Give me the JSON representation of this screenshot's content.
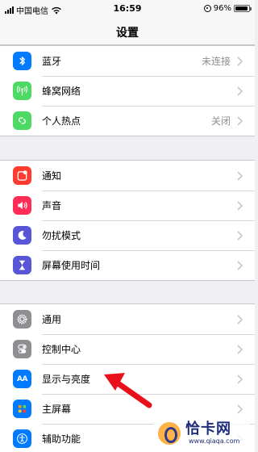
{
  "status_bar": {
    "carrier": "中国电信",
    "time": "16:59",
    "battery_text": "96%",
    "battery_level": 0.96
  },
  "nav": {
    "title": "设置"
  },
  "groups": [
    [
      {
        "label": "蓝牙",
        "value": "未连接",
        "icon": "bluetooth-icon",
        "color": "#007aff"
      },
      {
        "label": "蜂窝网络",
        "value": "",
        "icon": "cellular-icon",
        "color": "#4cd964"
      },
      {
        "label": "个人热点",
        "value": "关闭",
        "icon": "hotspot-icon",
        "color": "#4cd964"
      }
    ],
    [
      {
        "label": "通知",
        "value": "",
        "icon": "notifications-icon",
        "color": "#ff3b30"
      },
      {
        "label": "声音",
        "value": "",
        "icon": "sound-icon",
        "color": "#ff2d55"
      },
      {
        "label": "勿扰模式",
        "value": "",
        "icon": "moon-icon",
        "color": "#5856d6"
      },
      {
        "label": "屏幕使用时间",
        "value": "",
        "icon": "hourglass-icon",
        "color": "#5856d6"
      }
    ],
    [
      {
        "label": "通用",
        "value": "",
        "icon": "gear-icon",
        "color": "#8e8e93"
      },
      {
        "label": "控制中心",
        "value": "",
        "icon": "toggles-icon",
        "color": "#8e8e93"
      },
      {
        "label": "显示与亮度",
        "value": "",
        "icon": "text-size-icon",
        "color": "#007aff"
      },
      {
        "label": "主屏幕",
        "value": "",
        "icon": "home-screen-icon",
        "color": "#007aff"
      },
      {
        "label": "辅助功能",
        "value": "",
        "icon": "accessibility-icon",
        "color": "#007aff"
      }
    ]
  ],
  "icon_text": {
    "text_size": "AA"
  },
  "watermark": {
    "title": "恰卡网",
    "url": "www.qiaqa.com"
  }
}
